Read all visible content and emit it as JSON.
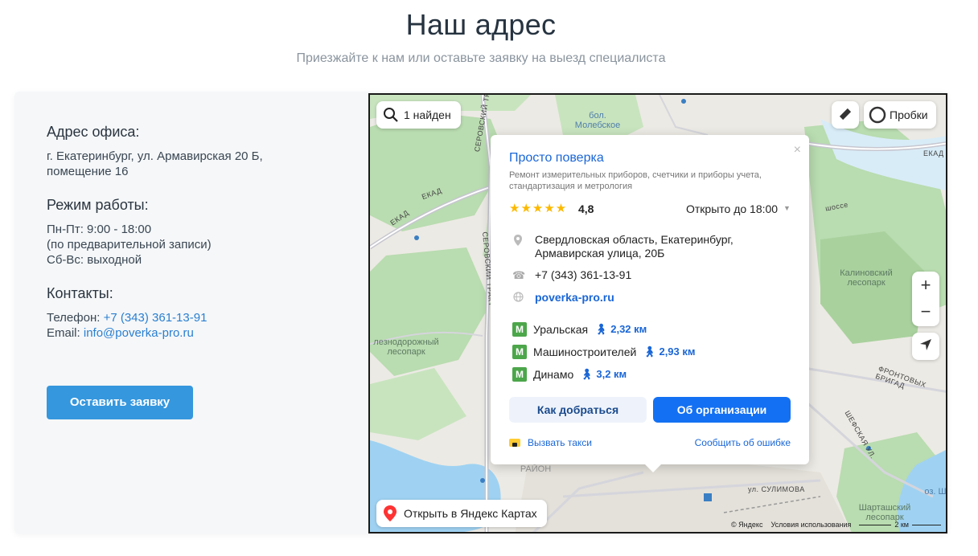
{
  "header": {
    "title": "Наш адрес",
    "subtitle": "Приезжайте к нам или оставьте заявку на выезд специалиста"
  },
  "contacts": {
    "address_heading": "Адрес офиса:",
    "address_line1": "г. Екатеринбург, ул. Армавирская 20 Б,",
    "address_line2": "помещение 16",
    "hours_heading": "Режим работы:",
    "hours_line1": "Пн-Пт: 9:00 - 18:00",
    "hours_line2": "(по предварительной записи)",
    "hours_line3": "Сб-Вс: выходной",
    "contacts_heading": "Контакты:",
    "phone_label": "Телефон:",
    "phone": "+7 (343) 361-13-91",
    "email_label": "Email:",
    "email": "info@poverka-pro.ru",
    "request_button": "Оставить заявку"
  },
  "map": {
    "search_chip": "1 найден",
    "traffic_chip": "Пробки",
    "open_in_maps": "Открыть в Яндекс Картах",
    "zoom_in": "+",
    "zoom_out": "−",
    "labels": {
      "bolota": "бол.\nМолебское",
      "ekad1": "ЕКАД",
      "ekad2": "ЕКАД",
      "ekad3": "ЕКАД",
      "serov1": "СЕРОВСКИЙ ТРАКТ",
      "serov2": "СЕРОВСКИЙ ТРАКТ",
      "kalinov": "Калиновский\nлесопарк",
      "zhelez": "лезнодорожный\nлесопарк",
      "shartash": "Шарташский\nлесопарк",
      "raion": "РАЙОН",
      "sulimova": "ул. СУЛИМОВА",
      "shefskaya": "ШЕФСКАЯ УЛ.",
      "frontovyh": "ФРОНТОВЫХ БРИГАД",
      "oz": "оз. Ш",
      "shosse": "шоссе"
    },
    "credits": {
      "yandex": "© Яндекс",
      "terms": "Условия использования",
      "scale": "2 км"
    },
    "popup": {
      "name": "Просто поверка",
      "close": "×",
      "description": "Ремонт измерительных приборов, счетчики и приборы учета, стандартизация и метрология",
      "stars": "★★★★★",
      "rating": "4,8",
      "open_status": "Открыто до 18:00",
      "address_line1": "Свердловская область, Екатеринбург,",
      "address_line2": "Армавирская улица, 20Б",
      "phone": "+7 (343) 361-13-91",
      "website": "poverka-pro.ru",
      "metro": [
        {
          "name": "Уральская",
          "distance": "2,32 км"
        },
        {
          "name": "Машиностроителей",
          "distance": "2,93 км"
        },
        {
          "name": "Динамо",
          "distance": "3,2 км"
        }
      ],
      "route_button": "Как добраться",
      "org_button": "Об организации",
      "taxi": "Вызвать такси",
      "report_error": "Сообщить об ошибке"
    }
  },
  "colors": {
    "accent": "#3597de",
    "link": "#2a7fd0",
    "map_link": "#1a66d6",
    "primary_button": "#1370f2",
    "metro": "#4ca64a",
    "stars": "#fcb900"
  }
}
